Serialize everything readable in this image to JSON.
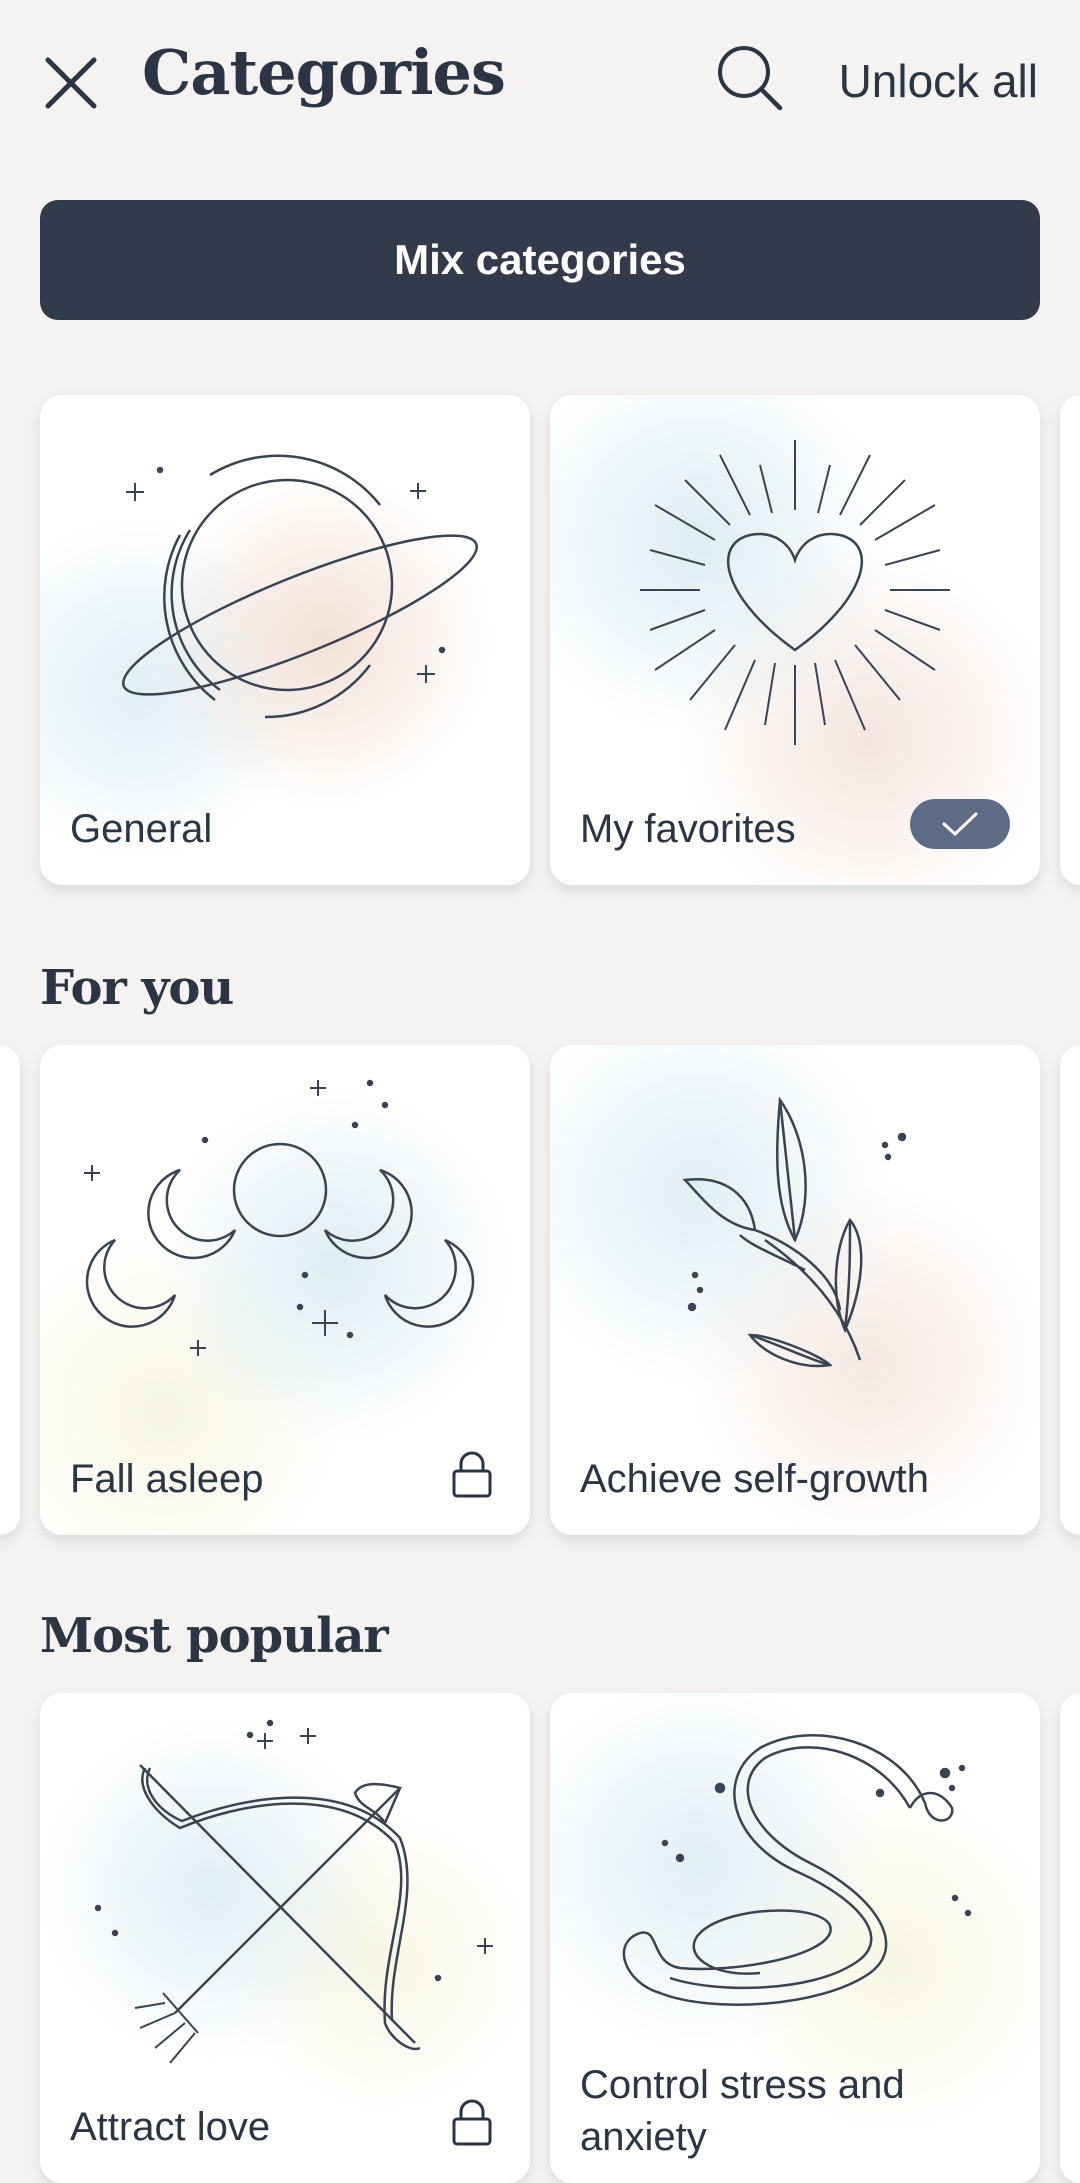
{
  "header": {
    "title": "Categories",
    "unlock_label": "Unlock all",
    "close_icon": "close-icon",
    "search_icon": "search-icon"
  },
  "mix_button": {
    "label": "Mix categories"
  },
  "top_cards": [
    {
      "label": "General",
      "icon": "planet-icon"
    },
    {
      "label": "My favorites",
      "icon": "heart-rays-icon",
      "selected": true
    }
  ],
  "sections": [
    {
      "title": "For you",
      "cards": [
        {
          "label": "Fall asleep",
          "icon": "moon-phases-icon",
          "locked": true
        },
        {
          "label": "Achieve self-growth",
          "icon": "leaf-branch-icon",
          "locked": false
        }
      ]
    },
    {
      "title": "Most popular",
      "cards": [
        {
          "label": "Attract love",
          "icon": "bow-arrow-icon",
          "locked": true
        },
        {
          "label": "Control stress and anxiety",
          "icon": "snake-icon",
          "locked": false
        }
      ]
    }
  ],
  "colors": {
    "background": "#f4f3f1",
    "primary": "#313b4b",
    "badge": "#5d6b85",
    "text": "#2b3544"
  }
}
